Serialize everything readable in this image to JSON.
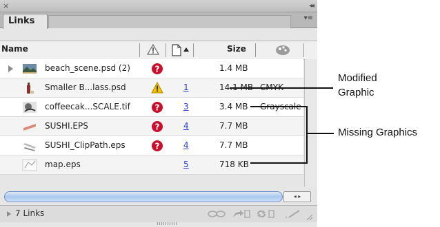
{
  "window": {
    "close_glyph": "×",
    "collapse_glyph": "◂◂"
  },
  "panel": {
    "tab_label": "Links",
    "menu_glyph": "▾≡"
  },
  "columns": {
    "name": "Name",
    "size": "Size"
  },
  "links": [
    {
      "name": "beach_scene.psd (2)",
      "status": "missing",
      "page": "",
      "size": "1.4 MB",
      "color_space": "",
      "has_children": true,
      "thumb": "landscape-thumb-icon"
    },
    {
      "name": "Smaller B...lass.psd",
      "status": "modified",
      "page": "1",
      "size": "14.1 MB",
      "color_space": "CMYK",
      "has_children": false,
      "thumb": "bottle-thumb-icon"
    },
    {
      "name": "coffeecak...SCALE.tif",
      "status": "missing",
      "page": "3",
      "size": "3.4 MB",
      "color_space": "Grayscale",
      "has_children": false,
      "thumb": "grayscale-thumb-icon"
    },
    {
      "name": "SUSHI.EPS",
      "status": "missing",
      "page": "4",
      "size": "7.7 MB",
      "color_space": "",
      "has_children": false,
      "thumb": "sushi-thumb-icon"
    },
    {
      "name": "SUSHI_ClipPath.eps",
      "status": "missing",
      "page": "4",
      "size": "7.7 MB",
      "color_space": "",
      "has_children": false,
      "thumb": "sushi-clip-thumb-icon"
    },
    {
      "name": "map.eps",
      "status": "ok",
      "page": "5",
      "size": "718 KB",
      "color_space": "",
      "has_children": false,
      "thumb": "map-thumb-icon"
    }
  ],
  "footer": {
    "count_text": "7 Links"
  },
  "callouts": {
    "modified_line1": "Modified",
    "modified_line2": "Graphic",
    "missing": "Missing Graphics"
  },
  "colors": {
    "missing": "#c8102e",
    "modified": "#f2c200",
    "page_link": "#2a3fd0",
    "scroll_accent": "#a9c7ee"
  }
}
